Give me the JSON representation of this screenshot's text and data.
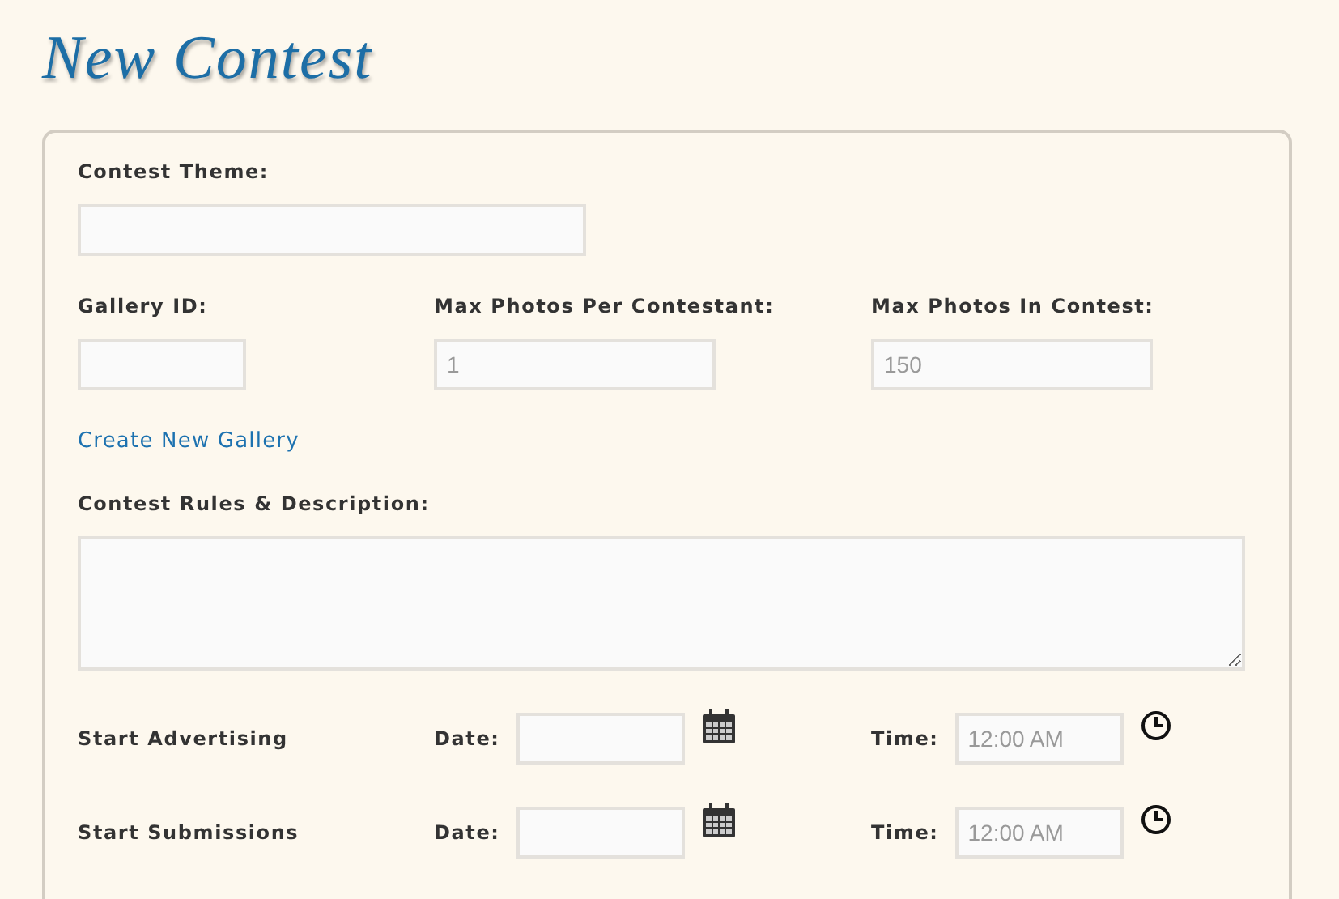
{
  "title": "New Contest",
  "contest_theme": {
    "label": "Contest Theme:"
  },
  "fields": [
    {
      "label": "Gallery ID:"
    },
    {
      "label": "Max Photos Per Contestant:",
      "placeholder": "1"
    },
    {
      "label": "Max Photos In Contest:",
      "placeholder": "150"
    }
  ],
  "create_gallery_link": "Create New Gallery",
  "rules": {
    "label": "Contest Rules & Description:"
  },
  "schedule": [
    {
      "label": "Start Advertising",
      "date_label": "Date:",
      "time_label": "Time:",
      "time_placeholder": "12:00 AM"
    },
    {
      "label": "Start Submissions",
      "date_label": "Date:",
      "time_label": "Time:",
      "time_placeholder": "12:00 AM"
    }
  ]
}
